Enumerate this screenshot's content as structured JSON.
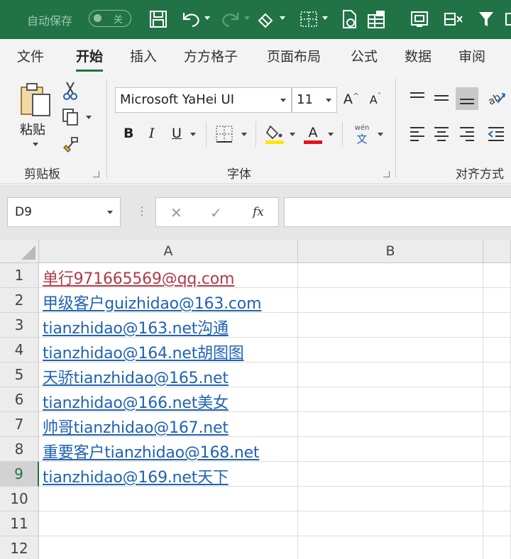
{
  "titlebar": {
    "autosave_label": "自动保存",
    "autosave_state": "关",
    "accent_color": "#217346"
  },
  "tabs": [
    "文件",
    "开始",
    "插入",
    "方方格子",
    "页面布局",
    "公式",
    "数据",
    "审阅"
  ],
  "active_tab": "开始",
  "ribbon": {
    "clipboard": {
      "paste_label": "粘贴",
      "group_label": "剪贴板"
    },
    "font": {
      "font_name": "Microsoft YaHei UI",
      "font_size": "11",
      "bold": "B",
      "italic": "I",
      "underline": "U",
      "font_color_glyph": "A",
      "grow_glyph": "A",
      "shrink_glyph": "A",
      "phonetic_top": "wén",
      "phonetic_bottom": "文",
      "group_label": "字体"
    },
    "alignment": {
      "group_label": "对齐方式"
    }
  },
  "formula_bar": {
    "name_box": "D9",
    "cancel_glyph": "✕",
    "enter_glyph": "✓",
    "fx_label": "fx",
    "formula": ""
  },
  "sheet": {
    "columns": [
      "A",
      "B"
    ],
    "active_row": 9,
    "rows": [
      {
        "num": "1",
        "a": "单行971665569@qq.com",
        "visited": true
      },
      {
        "num": "2",
        "a": "甲级客户guizhidao@163.com",
        "visited": false
      },
      {
        "num": "3",
        "a": "tianzhidao@163.net沟通",
        "visited": false
      },
      {
        "num": "4",
        "a": "tianzhidao@164.net胡图图",
        "visited": false
      },
      {
        "num": "5",
        "a": "天骄tianzhidao@165.net",
        "visited": false
      },
      {
        "num": "6",
        "a": "tianzhidao@166.net美女",
        "visited": false
      },
      {
        "num": "7",
        "a": "帅哥tianzhidao@167.net",
        "visited": false
      },
      {
        "num": "8",
        "a": "重要客户tianzhidao@168.net",
        "visited": false
      },
      {
        "num": "9",
        "a": "tianzhidao@169.net天下",
        "visited": false
      },
      {
        "num": "10",
        "a": "",
        "visited": false
      },
      {
        "num": "11",
        "a": "",
        "visited": false
      },
      {
        "num": "12",
        "a": "",
        "visited": false
      }
    ],
    "link_color": "#1f62b4",
    "visited_link_color": "#b23a4a"
  }
}
